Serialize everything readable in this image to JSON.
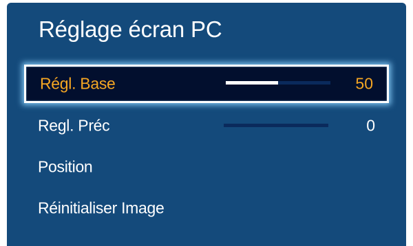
{
  "menu": {
    "title": "Réglage écran PC",
    "items": [
      {
        "label": "Régl. Base",
        "value": "50",
        "level": 0.5,
        "selected": true
      },
      {
        "label": "Regl. Préc",
        "value": "0",
        "level": 0.0,
        "selected": false
      },
      {
        "label": "Position"
      },
      {
        "label": "Réinitialiser Image"
      }
    ]
  },
  "colors": {
    "panel_bg": "#144a7b",
    "selected_bg": "#020f2e",
    "highlight_text": "#f5a623",
    "glow": "#8cd2ff",
    "track": "#0a2a5c"
  }
}
